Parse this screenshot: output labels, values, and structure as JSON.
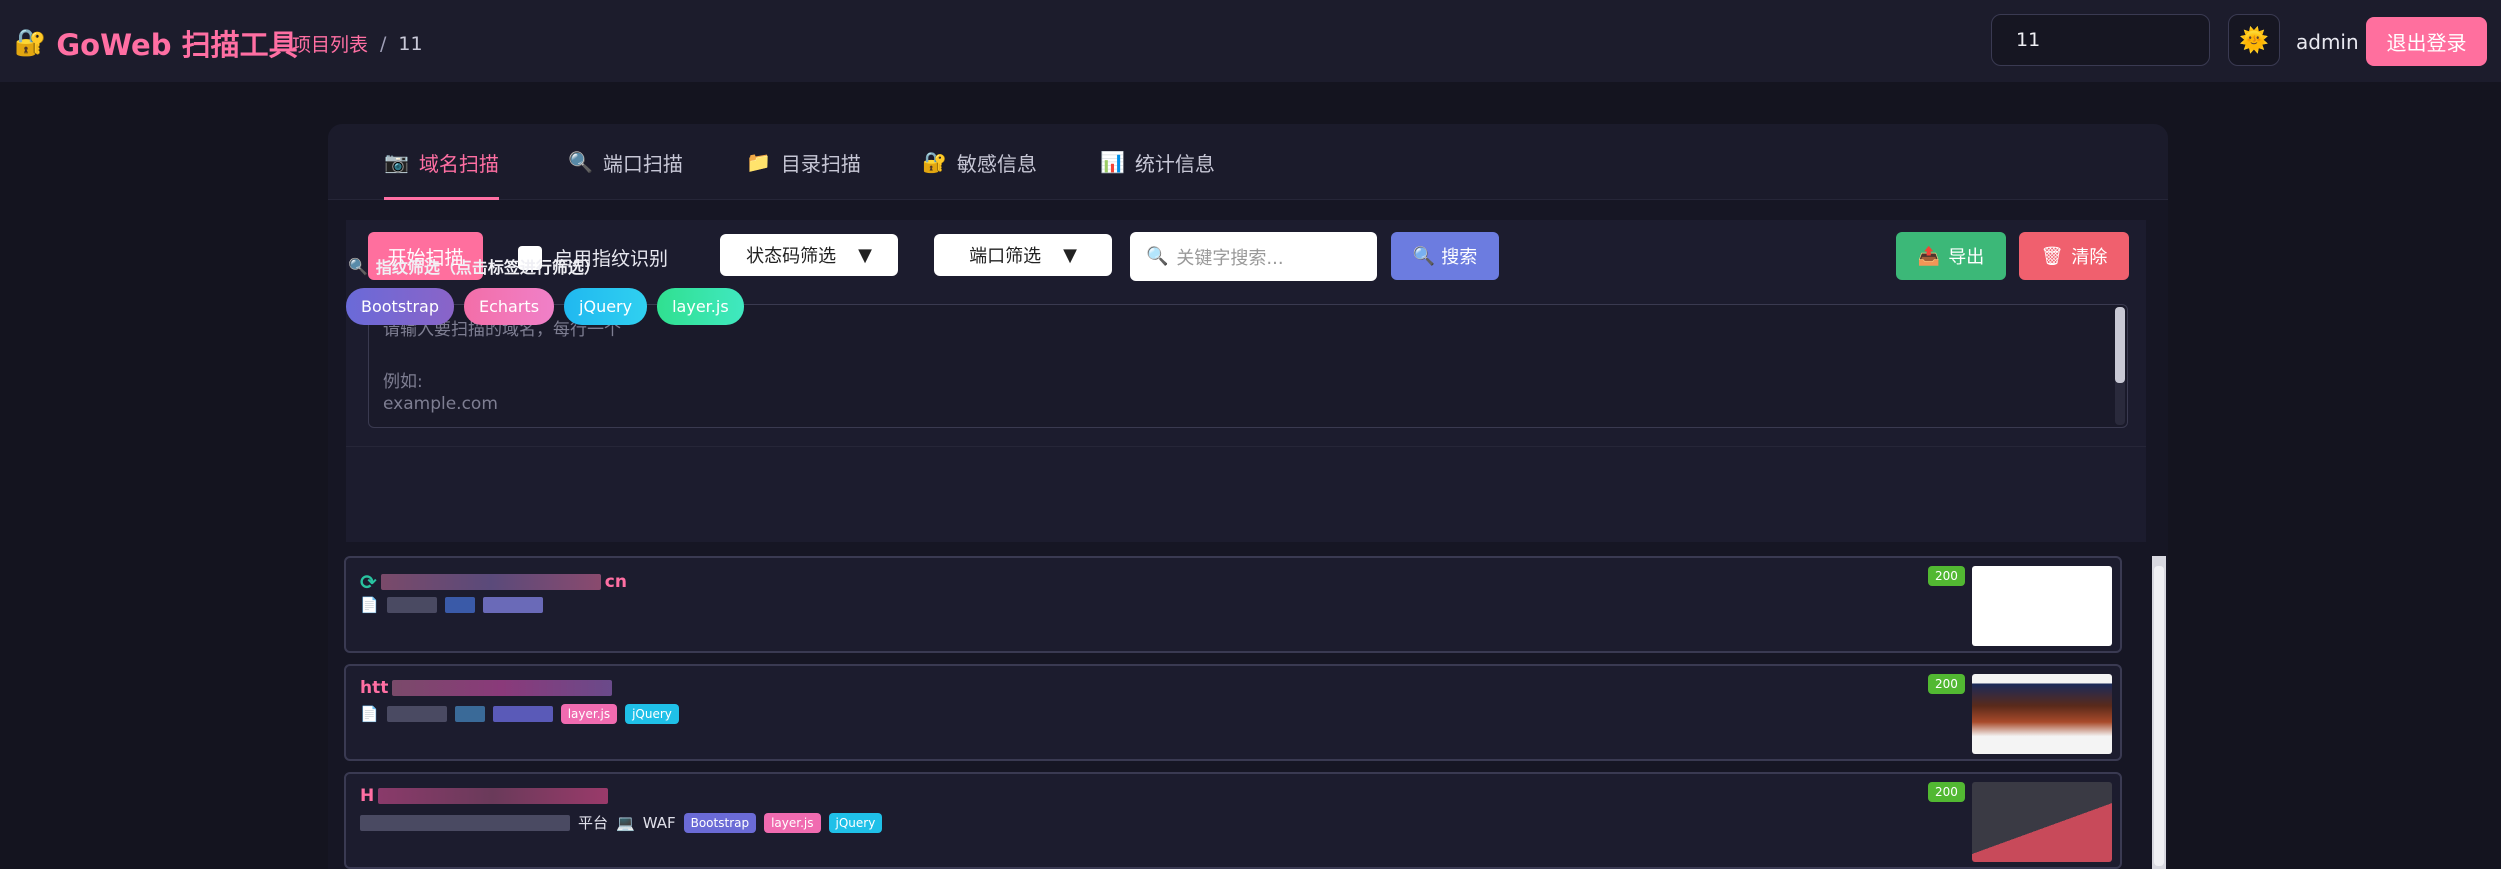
{
  "header": {
    "logo_icon": "🔐",
    "title": "GoWeb 扫描工具",
    "breadcrumb": {
      "root": "项目列表",
      "separator": "/",
      "current": "11"
    },
    "project_select": "11",
    "theme_icon": "🌞",
    "user": "admin",
    "logout": "退出登录"
  },
  "tabs": [
    {
      "icon": "📷",
      "label": "域名扫描"
    },
    {
      "icon": "🔍",
      "label": "端口扫描"
    },
    {
      "icon": "📁",
      "label": "目录扫描"
    },
    {
      "icon": "🔐",
      "label": "敏感信息"
    },
    {
      "icon": "📊",
      "label": "统计信息"
    }
  ],
  "toolbar": {
    "start": "开始扫描",
    "fingerprint": "启用指纹识别",
    "status_filter": "状态码筛选",
    "port_filter": "端口筛选",
    "dropdown_arrow": "▼",
    "search_icon": "🔍",
    "search_placeholder": "关键字搜索...",
    "search": "搜索",
    "export_icon": "📤",
    "export": "导出",
    "clear_icon": "🗑",
    "clear": "清除"
  },
  "textarea": {
    "line1": "请输入要扫描的域名，每行一个",
    "line2": "例如:",
    "line3": "example.com"
  },
  "fingerprint_filter": {
    "icon": "🔍",
    "title": "指纹筛选（点击标签进行筛选）",
    "tags": [
      "Bootstrap",
      "Echarts",
      "jQuery",
      "layer.js"
    ]
  },
  "results": [
    {
      "url_tail": "cn",
      "status": "200",
      "tags": []
    },
    {
      "url_head": "htt",
      "status": "200",
      "tags": [
        "layer.js",
        "jQuery"
      ]
    },
    {
      "url_head": "H",
      "status": "200",
      "platform": "平台",
      "waf_icon": "💻",
      "waf": "WAF",
      "tags": [
        "Bootstrap",
        "layer.js",
        "jQuery"
      ]
    }
  ],
  "colors": {
    "accent": "#ff6fa3",
    "bootstrap": "#6b6bd6",
    "echarts": "#f06bb0",
    "jquery": "#1fc0e8",
    "layerjs": "#2ee0a0",
    "status_ok": "#52b832"
  }
}
